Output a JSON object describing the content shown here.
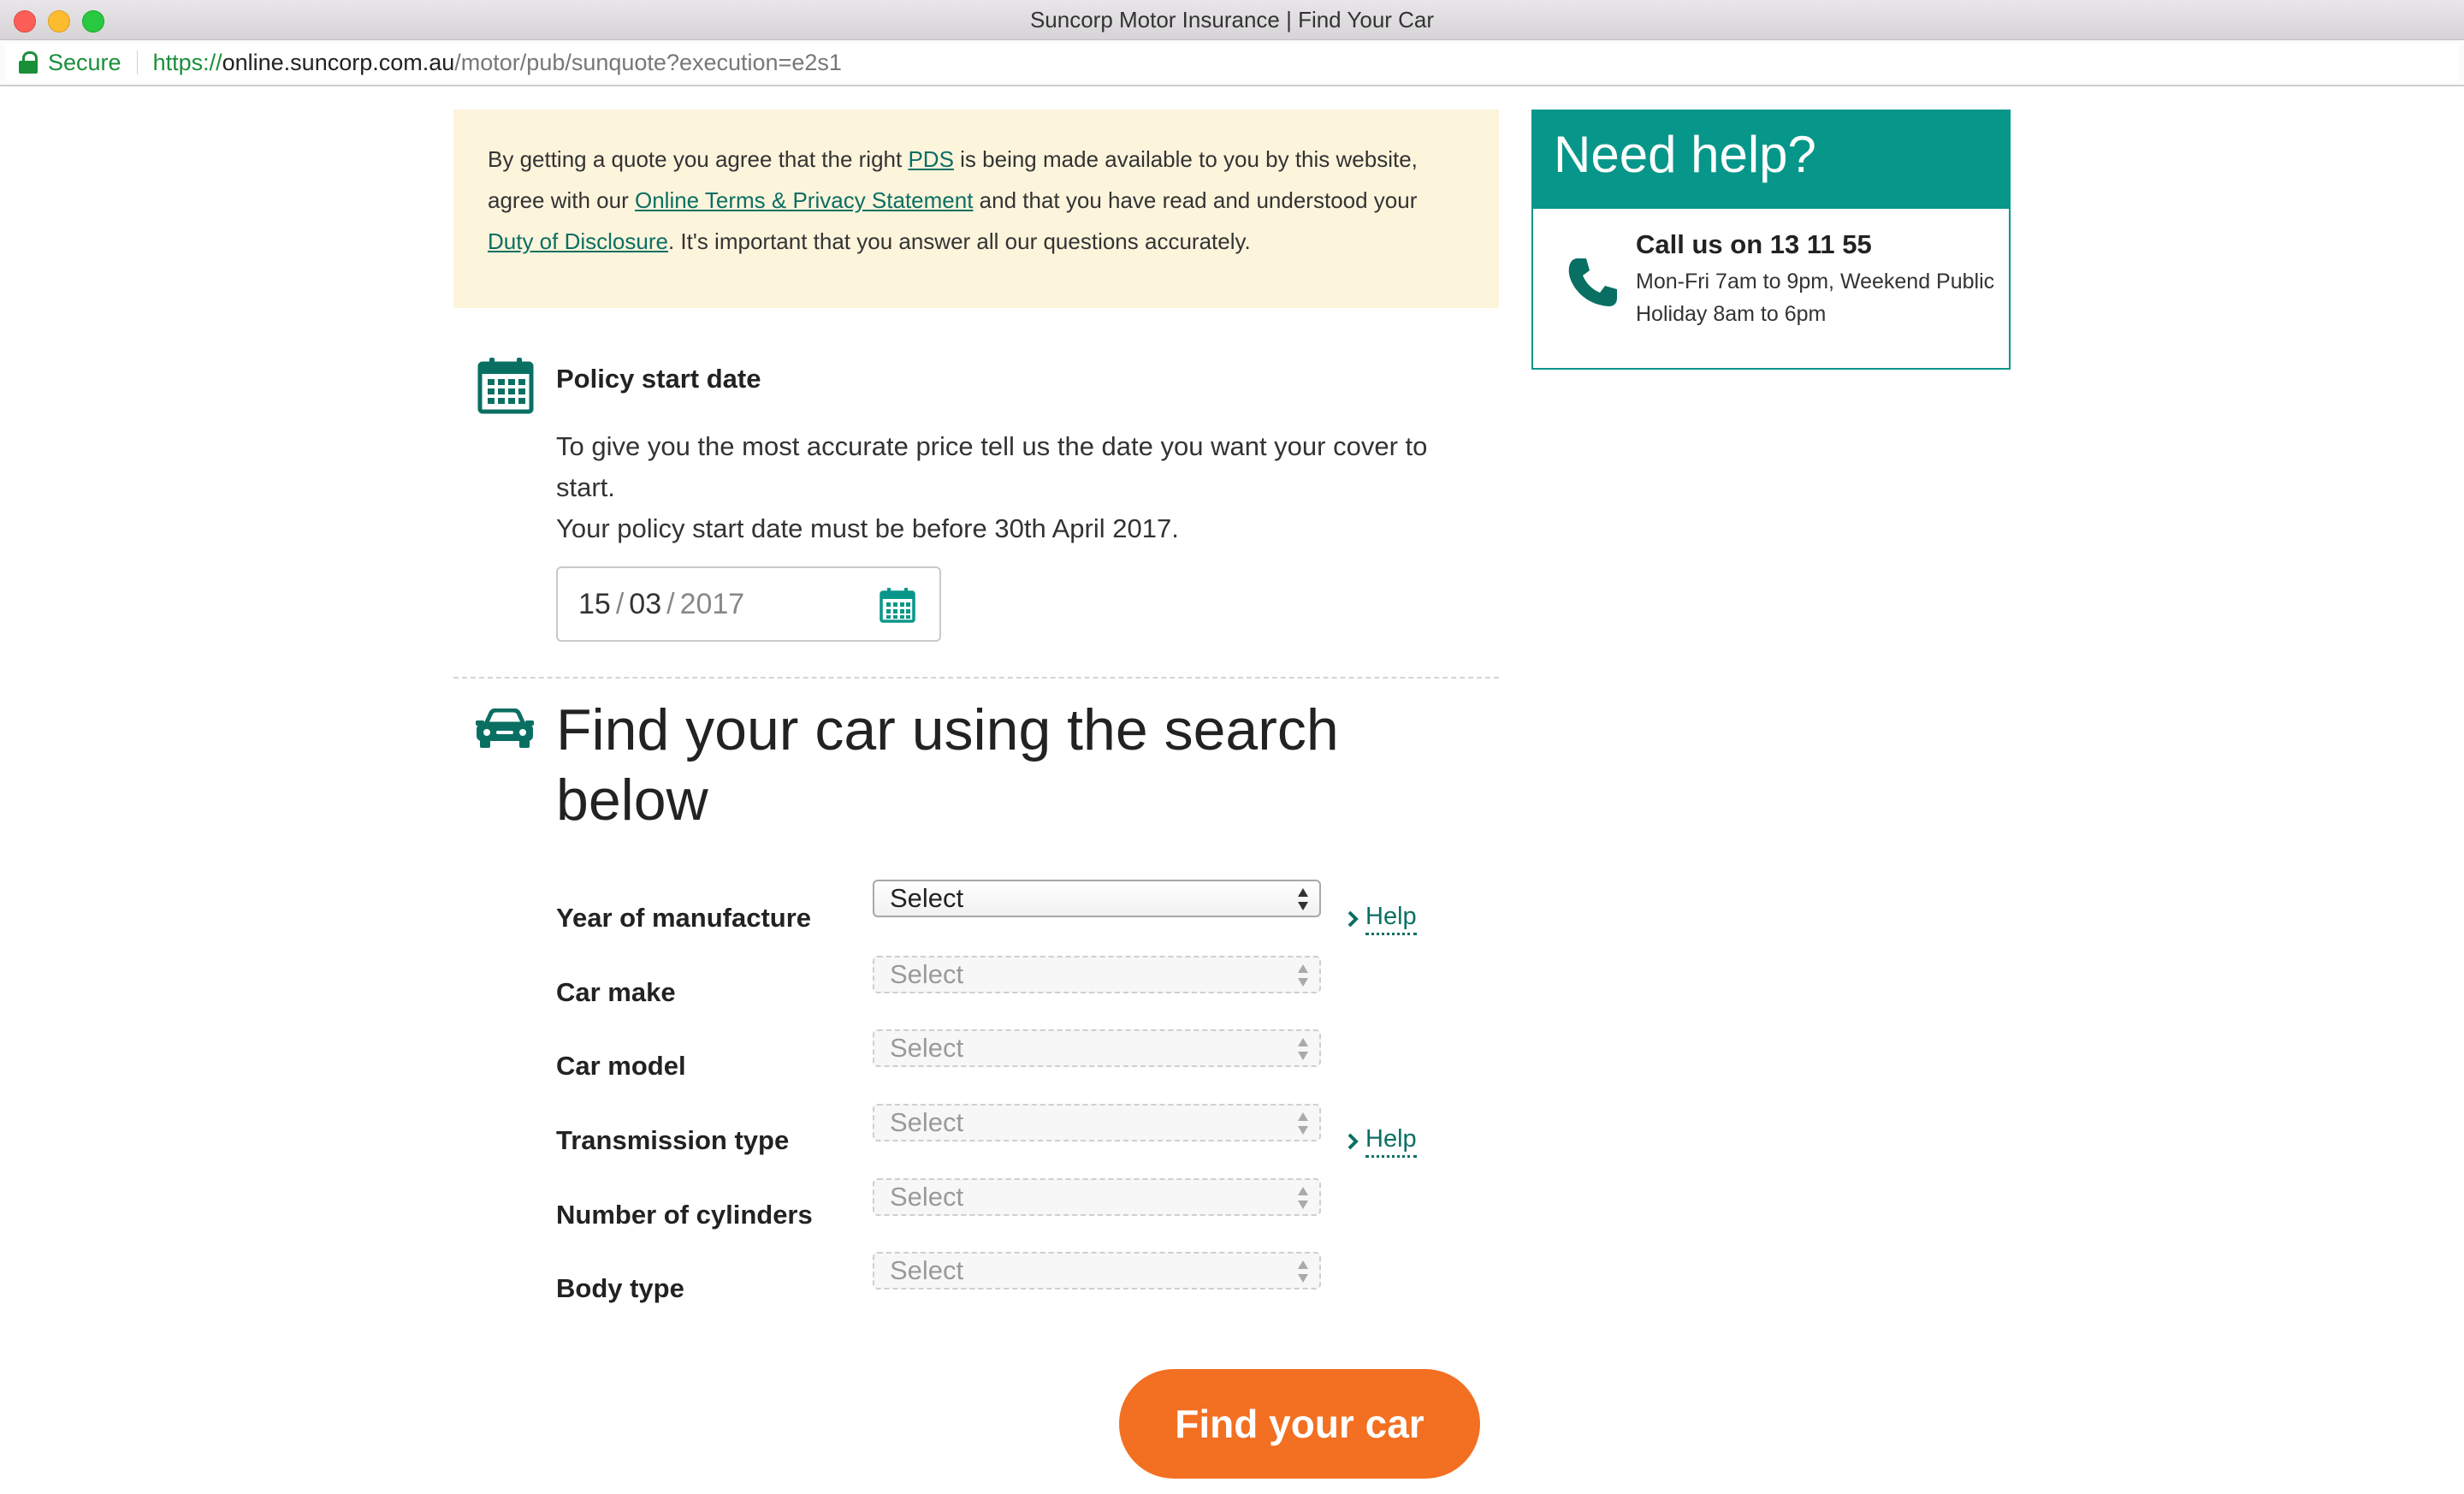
{
  "browser": {
    "window_title": "Suncorp Motor Insurance | Find Your Car",
    "secure_label": "Secure",
    "url_scheme": "https://",
    "url_host": "online.suncorp.com.au",
    "url_path": "/motor/pub/sunquote?execution=e2s1"
  },
  "consent": {
    "text_1": "By getting a quote you agree that the right ",
    "link_pds": "PDS",
    "text_2": " is being made available to you by this website, agree with our ",
    "link_terms": "Online Terms & Privacy Statement",
    "text_3": " and that you have read and understood your ",
    "link_duty": "Duty of Disclosure",
    "text_4": ". It's important that you answer all our questions accurately."
  },
  "policy": {
    "title": "Policy start date",
    "description_line1": "To give you the most accurate price tell us the date you want your cover to start.",
    "description_line2": "Your policy start date must be before 30th April 2017.",
    "date": {
      "day": "15",
      "month": "03",
      "year": "2017"
    }
  },
  "find_car": {
    "title": "Find your car using the search below",
    "help_label": "Help",
    "fields": [
      {
        "label": "Year of manufacture",
        "value": "Select",
        "enabled": true,
        "has_help": true
      },
      {
        "label": "Car make",
        "value": "Select",
        "enabled": false,
        "has_help": false
      },
      {
        "label": "Car model",
        "value": "Select",
        "enabled": false,
        "has_help": false
      },
      {
        "label": "Transmission type",
        "value": "Select",
        "enabled": false,
        "has_help": true
      },
      {
        "label": "Number of cylinders",
        "value": "Select",
        "enabled": false,
        "has_help": false
      },
      {
        "label": "Body type",
        "value": "Select",
        "enabled": false,
        "has_help": false
      }
    ],
    "button_label": "Find your car"
  },
  "help_panel": {
    "title": "Need help?",
    "call_title": "Call us on 13 11 55",
    "call_hours": "Mon-Fri 7am to 9pm, Weekend Public Holiday 8am to 6pm"
  },
  "colors": {
    "brand_teal": "#07968a",
    "link_teal": "#0a6f63",
    "button_orange": "#f36f21",
    "notice_background": "#fdf4dc"
  },
  "icons": [
    "lock-icon",
    "calendar-icon",
    "car-icon",
    "chevron-right-icon",
    "phone-icon",
    "select-arrows-icon"
  ]
}
